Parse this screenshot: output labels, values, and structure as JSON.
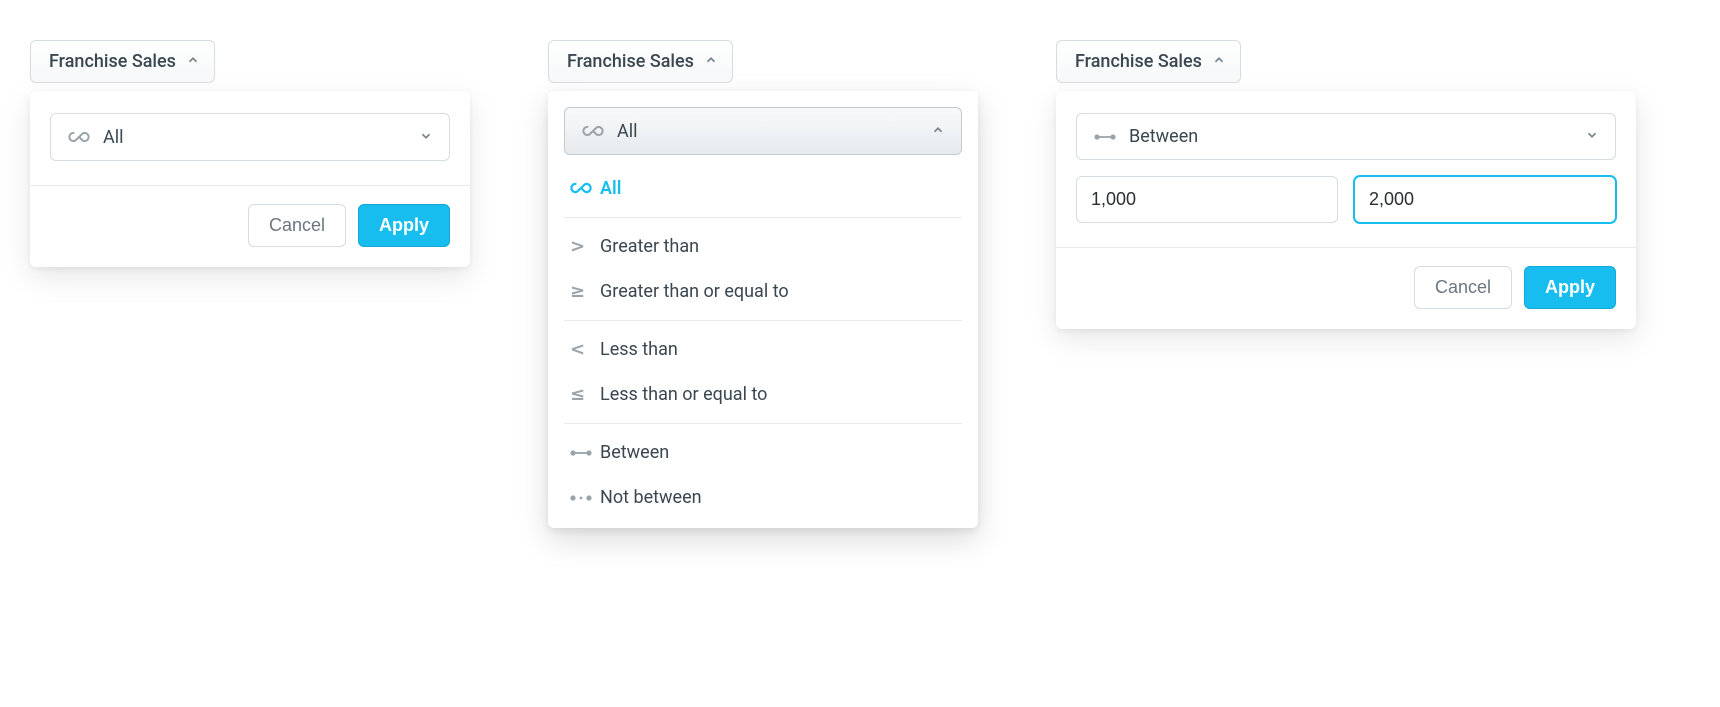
{
  "panels": [
    {
      "field_name": "Franchise Sales",
      "selector": {
        "icon": "infinity",
        "label": "All",
        "state": "closed"
      },
      "actions": {
        "cancel": "Cancel",
        "apply": "Apply"
      }
    },
    {
      "field_name": "Franchise Sales",
      "selector": {
        "icon": "infinity",
        "label": "All",
        "state": "open"
      },
      "options": [
        {
          "icon": "infinity",
          "label": "All",
          "selected": true,
          "sep_after": true
        },
        {
          "icon": "gt",
          "label": "Greater than"
        },
        {
          "icon": "gte",
          "label": "Greater than or equal to",
          "sep_after": true
        },
        {
          "icon": "lt",
          "label": "Less than"
        },
        {
          "icon": "lte",
          "label": "Less than or equal to",
          "sep_after": true
        },
        {
          "icon": "between",
          "label": "Between"
        },
        {
          "icon": "not_between",
          "label": "Not between"
        }
      ]
    },
    {
      "field_name": "Franchise Sales",
      "selector": {
        "icon": "between",
        "label": "Between",
        "state": "closed"
      },
      "range": {
        "from": "1,000",
        "to": "2,000",
        "focused": "to"
      },
      "actions": {
        "cancel": "Cancel",
        "apply": "Apply"
      }
    }
  ],
  "icons": {
    "infinity": "∞",
    "gt": ">",
    "gte": "≥",
    "lt": "<",
    "lte": "≤"
  }
}
